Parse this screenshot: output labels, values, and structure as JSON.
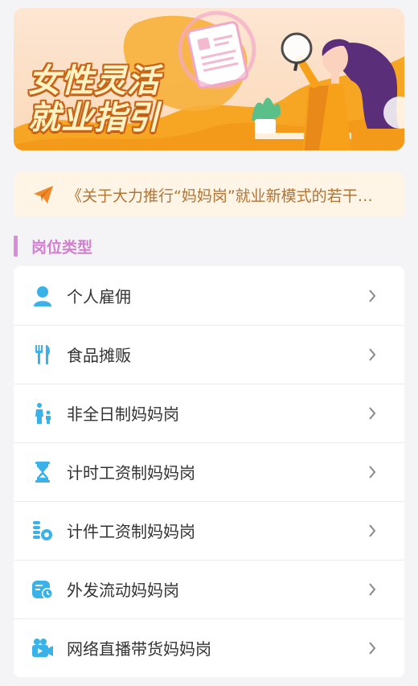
{
  "banner": {
    "title_line1": "女性灵活",
    "title_line2": "就业指引"
  },
  "notice": {
    "icon": "paper-plane-icon",
    "text": "《关于大力推行“妈妈岗”就业新模式的若干…"
  },
  "section": {
    "title": "岗位类型"
  },
  "colors": {
    "accent_icon": "#3ab2e8",
    "notice_bg": "#fef5e6",
    "notice_text": "#b27435",
    "section_accent": "#d98dd7",
    "banner_orange": "#f7a624"
  },
  "items": [
    {
      "label": "个人雇佣",
      "icon": "person-icon"
    },
    {
      "label": "食品摊贩",
      "icon": "fork-knife-icon"
    },
    {
      "label": "非全日制妈妈岗",
      "icon": "parent-child-icon"
    },
    {
      "label": "计时工资制妈妈岗",
      "icon": "hourglass-icon"
    },
    {
      "label": "计件工资制妈妈岗",
      "icon": "coins-icon"
    },
    {
      "label": "外发流动妈妈岗",
      "icon": "clock-card-icon"
    },
    {
      "label": "网络直播带货妈妈岗",
      "icon": "video-camera-icon"
    }
  ]
}
